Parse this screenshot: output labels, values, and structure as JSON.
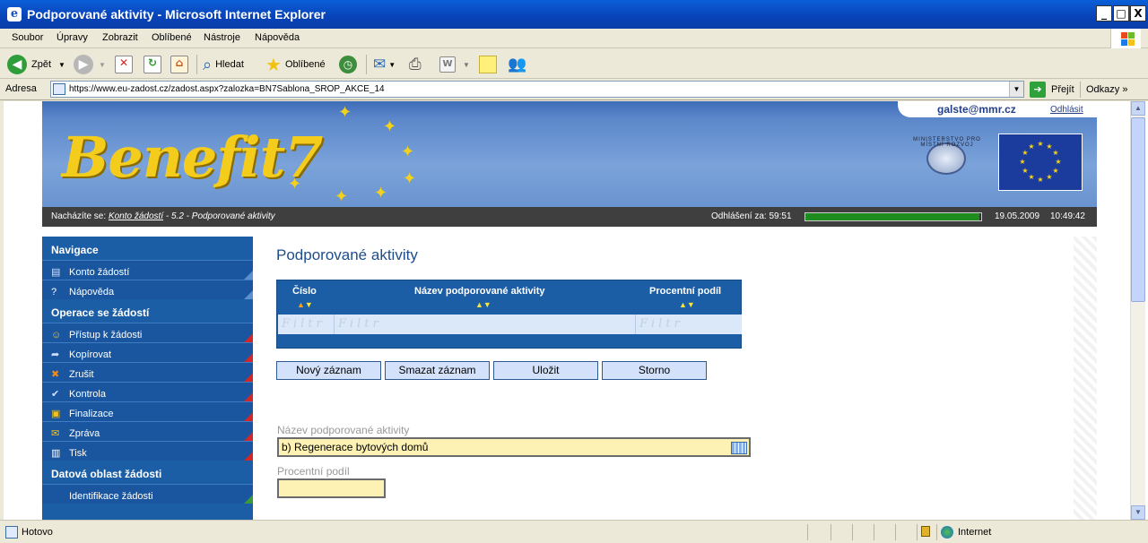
{
  "window": {
    "title": "Podporované aktivity - Microsoft Internet Explorer",
    "min": "_",
    "max": "□",
    "close": "X"
  },
  "menu": [
    "Soubor",
    "Úpravy",
    "Zobrazit",
    "Oblíbené",
    "Nástroje",
    "Nápověda"
  ],
  "toolbar": {
    "back": "Zpět",
    "search": "Hledat",
    "favorites": "Oblíbené"
  },
  "address": {
    "label": "Adresa",
    "url": "https://www.eu-zadost.cz/zadost.aspx?zalozka=BN7Sablona_SROP_AKCE_14",
    "go": "Přejít",
    "links": "Odkazy"
  },
  "header": {
    "brand": "Benefit7",
    "user": "galste@mmr.cz",
    "logout": "Odhlásit",
    "ministry": "MINISTERSTVO PRO MÍSTNÍ ROZVOJ"
  },
  "status_strip": {
    "location_prefix": "Nacházíte se:",
    "location_link": "Konto žádostí",
    "location_rest": " - 5.2 - Podporované aktivity",
    "timer_label": "Odhlášení za: 59:51",
    "session_remaining": 0.99,
    "date": "19.05.2009",
    "time": "10:49:42"
  },
  "nav": {
    "sections": [
      {
        "title": "Navigace",
        "items": [
          {
            "label": "Konto žádostí",
            "icon": "book-icon",
            "corner": "blu"
          },
          {
            "label": "Nápověda",
            "icon": "help-icon",
            "corner": "blu"
          }
        ]
      },
      {
        "title": "Operace se žádostí",
        "items": [
          {
            "label": "Přístup k žádosti",
            "icon": "users-icon",
            "corner": "red"
          },
          {
            "label": "Kopírovat",
            "icon": "copy-arrow-icon",
            "corner": "red"
          },
          {
            "label": "Zrušit",
            "icon": "cancel-icon",
            "corner": "red"
          },
          {
            "label": "Kontrola",
            "icon": "check-icon",
            "corner": "red"
          },
          {
            "label": "Finalizace",
            "icon": "lock-icon",
            "corner": "red"
          },
          {
            "label": "Zpráva",
            "icon": "envelope-icon",
            "corner": "red"
          },
          {
            "label": "Tisk",
            "icon": "print-icon",
            "corner": "red"
          }
        ]
      },
      {
        "title": "Datová oblast žádosti",
        "items": [
          {
            "label": "Identifikace žádosti",
            "icon": "",
            "corner": "grn"
          }
        ]
      }
    ]
  },
  "main": {
    "title": "Podporované aktivity",
    "grid": {
      "columns": [
        "Číslo",
        "Název podporované aktivity",
        "Procentní podíl"
      ],
      "filter_placeholder": "Filtr"
    },
    "buttons": {
      "new": "Nový záznam",
      "delete": "Smazat záznam",
      "save": "Uložit",
      "cancel": "Storno"
    },
    "form": {
      "activity_label": "Název podporované aktivity",
      "activity_value": "b) Regenerace bytových domů",
      "percent_label": "Procentní podíl",
      "percent_value": ""
    }
  },
  "statusbar": {
    "text": "Hotovo",
    "zone": "Internet"
  }
}
